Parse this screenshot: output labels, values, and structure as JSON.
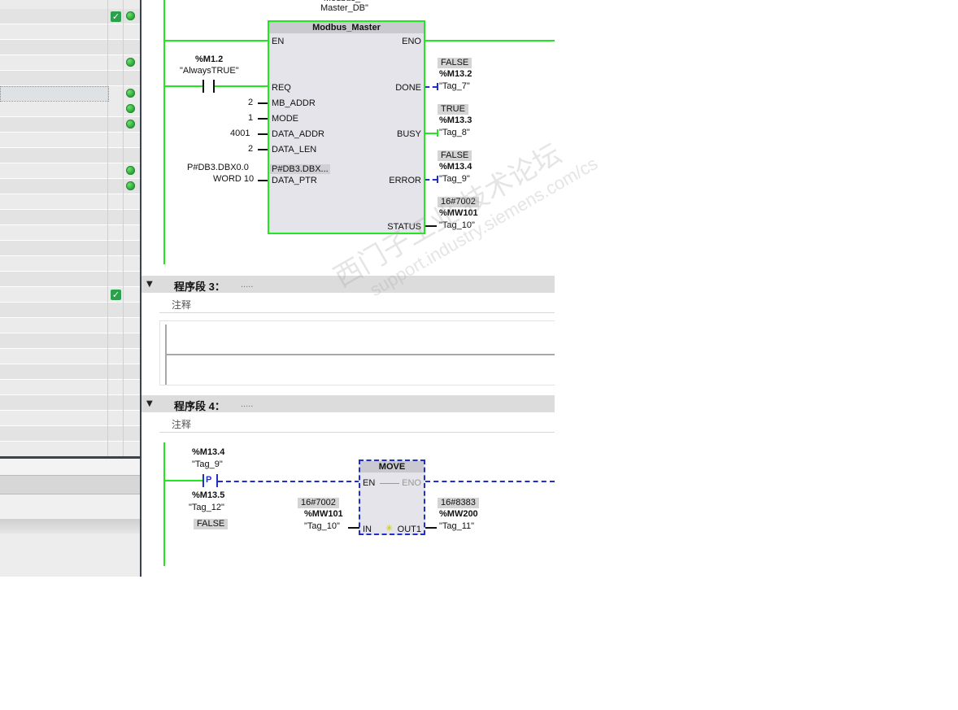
{
  "net2": {
    "db_name_line": "Master_DB\"",
    "block": {
      "title": "Modbus_Master",
      "inputs": [
        "EN",
        "REQ",
        "MB_ADDR",
        "MODE",
        "DATA_ADDR",
        "DATA_LEN",
        "DATA_PTR"
      ],
      "outputs": [
        "ENO",
        "DONE",
        "BUSY",
        "ERROR",
        "STATUS"
      ],
      "ptr_overflow": "P#DB3.DBX..."
    },
    "req_contact": {
      "address": "%M1.2",
      "tag": "\"AlwaysTRUE\""
    },
    "param_values": {
      "mb_addr": "2",
      "mode": "1",
      "data_addr": "4001",
      "data_len": "2",
      "data_ptr_1": "P#DB3.DBX0.0",
      "data_ptr_2": "WORD 10"
    },
    "outputs": [
      {
        "pin": "DONE",
        "value": "FALSE",
        "address": "%M13.2",
        "tag": "\"Tag_7\""
      },
      {
        "pin": "BUSY",
        "value": "TRUE",
        "address": "%M13.3",
        "tag": "\"Tag_8\""
      },
      {
        "pin": "ERROR",
        "value": "FALSE",
        "address": "%M13.4",
        "tag": "\"Tag_9\""
      },
      {
        "pin": "STATUS",
        "value": "16#7002",
        "address": "%MW101",
        "tag": "\"Tag_10\""
      }
    ]
  },
  "net3": {
    "title": "程序段 3：",
    "dots": ".....",
    "comment": "注释"
  },
  "net4": {
    "title": "程序段 4：",
    "dots": ".....",
    "comment": "注释",
    "p_contact": {
      "address": "%M13.4",
      "tag": "\"Tag_9\"",
      "symbol": "P"
    },
    "edge_mem": {
      "address": "%M13.5",
      "tag": "\"Tag_12\"",
      "value": "FALSE"
    },
    "move": {
      "title": "MOVE",
      "en": "EN",
      "eno": "ENO",
      "in": "IN",
      "out": "OUT1"
    },
    "in_operand": {
      "value": "16#7002",
      "address": "%MW101",
      "tag": "\"Tag_10\""
    },
    "out_operand": {
      "value": "16#8383",
      "address": "%MW200",
      "tag": "\"Tag_11\""
    }
  },
  "watermark": {
    "line1": "西门子工业 技术论坛",
    "line2": "support.industry.siemens.com/cs"
  },
  "colors": {
    "active_green": "#22e622",
    "online_blue": "#1f2fc8",
    "teal_address": "#1a9a9a",
    "constant_blue": "#2e6fc4"
  }
}
